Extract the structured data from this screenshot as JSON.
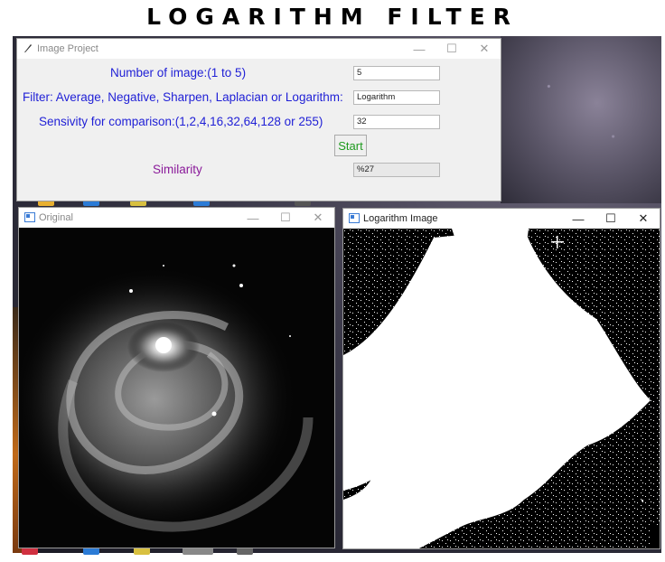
{
  "heading": "LOGARITHM FILTER",
  "project_window": {
    "title": "Image Project",
    "icon": "feather-icon",
    "controls": {
      "minimize": "—",
      "maximize": "☐",
      "close": "✕"
    },
    "fields": [
      {
        "label": "Number of image:(1 to 5)",
        "value": "5"
      },
      {
        "label": "Filter: Average, Negative, Sharpen, Laplacian or Logarithm:",
        "value": "Logarithm"
      },
      {
        "label": "Sensivity for comparison:(1,2,4,16,32,64,128 or 255)",
        "value": "32"
      }
    ],
    "start_label": "Start",
    "similarity_label": "Similarity",
    "similarity_value": "%27"
  },
  "original_window": {
    "title": "Original",
    "icon": "image-window-icon",
    "controls": {
      "minimize": "—",
      "maximize": "☐",
      "close": "✕"
    }
  },
  "log_window": {
    "title": "Logarithm Image",
    "icon": "image-window-icon",
    "controls": {
      "minimize": "—",
      "maximize": "☐",
      "close": "✕"
    }
  },
  "colors": {
    "label_blue": "#1f1fd6",
    "start_green": "#1e9a1e",
    "similarity_purple": "#8a1a9a"
  }
}
